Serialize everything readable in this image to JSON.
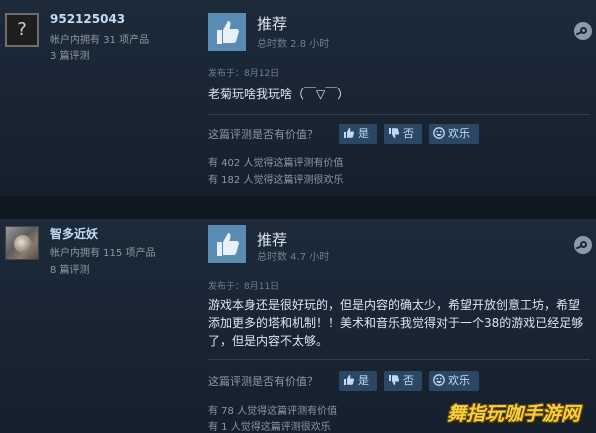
{
  "reviews": [
    {
      "user": {
        "name": "952125043",
        "products": "帐户内拥有 31 项产品",
        "reviews": "3 篇评测",
        "avatar": "unknown"
      },
      "verdict": "推荐",
      "hours": "总时数 2.8 小时",
      "posted": "发布于：8月12日",
      "text": "老菊玩啥我玩啥（￣▽￣）",
      "helpful_question": "这篇评测是否有价值？",
      "buttons": {
        "yes": "是",
        "no": "否",
        "funny": "欢乐"
      },
      "helpful_count": "有 402 人觉得这篇评测有价值",
      "funny_count": "有 182 人觉得这篇评测很欢乐"
    },
    {
      "user": {
        "name": "智多近妖",
        "products": "帐户内拥有 115 项产品",
        "reviews": "8 篇评测",
        "avatar": "image"
      },
      "verdict": "推荐",
      "hours": "总时数 4.7 小时",
      "posted": "发布于：8月11日",
      "text": "游戏本身还是很好玩的，但是内容的确太少，希望开放创意工坊，希望添加更多的塔和机制！！美术和音乐我觉得对于一个38的游戏已经足够了，但是内容不太够。",
      "helpful_question": "这篇评测是否有价值？",
      "buttons": {
        "yes": "是",
        "no": "否",
        "funny": "欢乐"
      },
      "helpful_count": "有 78 人觉得这篇评测有价值",
      "funny_count": "有 1 人觉得这篇评测很欢乐"
    }
  ],
  "icons": {
    "thumb": "thumbs-up-icon",
    "steam": "steam-logo-icon",
    "yes": "thumbs-up-icon",
    "no": "thumbs-down-icon",
    "funny": "smiley-icon",
    "unknown_avatar": "question-mark-icon"
  },
  "colors": {
    "background": "#1b2838",
    "thumb_bg": "#5a8bb3",
    "button_bg": "#2b4764",
    "link": "#c1dbf4"
  },
  "watermark": "舞指玩咖手游网"
}
